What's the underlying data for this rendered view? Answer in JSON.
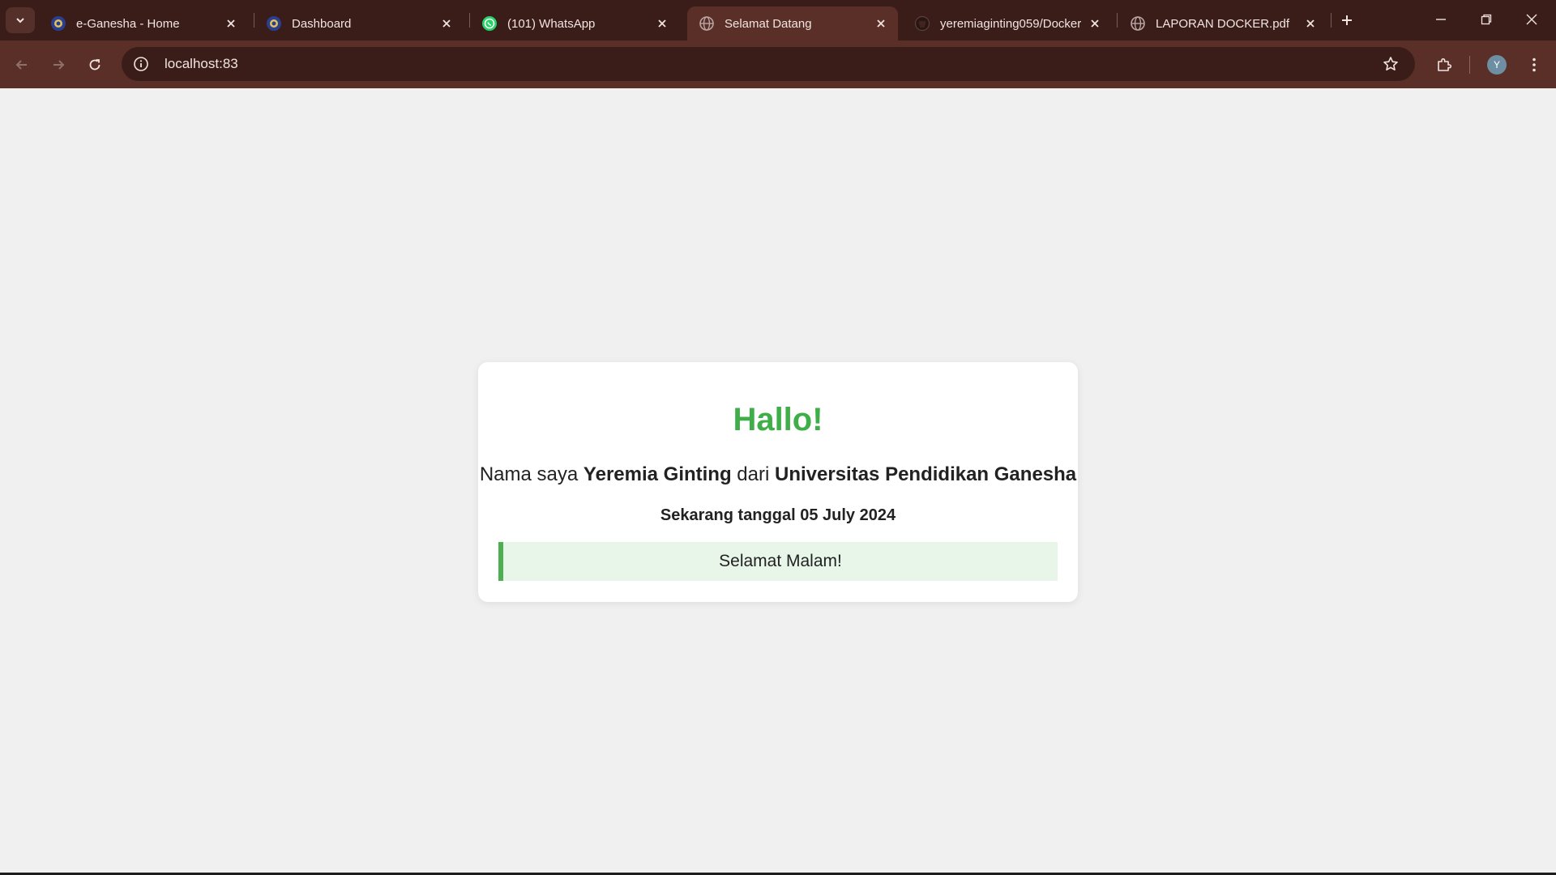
{
  "tabs": [
    {
      "title": "e-Ganesha - Home",
      "icon": "university-logo-icon"
    },
    {
      "title": "Dashboard",
      "icon": "university-logo-icon"
    },
    {
      "title": "(101) WhatsApp",
      "icon": "whatsapp-icon"
    },
    {
      "title": "Selamat Datang",
      "icon": "globe-icon",
      "active": true
    },
    {
      "title": "yeremiaginting059/Docker",
      "icon": "github-icon"
    },
    {
      "title": "LAPORAN DOCKER.pdf",
      "icon": "globe-icon"
    }
  ],
  "address_bar": {
    "url": "localhost:83"
  },
  "profile": {
    "initial": "Y"
  },
  "page": {
    "heading": "Hallo!",
    "intro_prefix": "Nama saya",
    "name": "Yeremia Ginting",
    "intro_middle": "dari",
    "university": "Universitas Pendidikan Ganesha",
    "date_text": "Sekarang tanggal 05 July 2024",
    "greeting": "Selamat Malam!"
  },
  "colors": {
    "tabstrip": "#3a1d19",
    "toolbar": "#5a2f28",
    "heading": "#3fae49",
    "greeting_bg": "#e8f5e9",
    "greeting_border": "#4caf50"
  }
}
